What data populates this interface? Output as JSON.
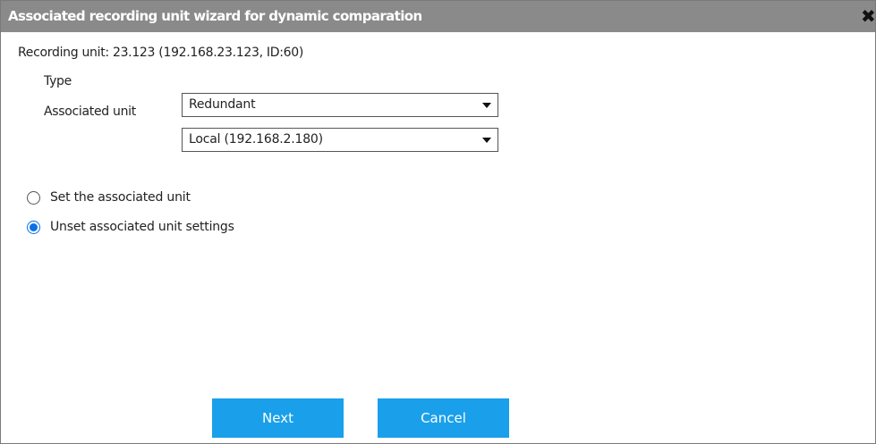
{
  "dialog": {
    "title": "Associated recording unit wizard for dynamic comparation",
    "close_glyph": "✖",
    "recording_unit": "Recording unit: 23.123 (192.168.23.123, ID:60)"
  },
  "form": {
    "type_label": "Type",
    "type_value": "Redundant",
    "associated_label": "Associated unit",
    "associated_value": "Local (192.168.2.180)"
  },
  "options": [
    {
      "label": "Set the associated unit",
      "checked": false
    },
    {
      "label": "Unset associated unit settings",
      "checked": true
    }
  ],
  "buttons": {
    "next": "Next",
    "cancel": "Cancel"
  },
  "colors": {
    "titlebar": "#8a8a8a",
    "accent": "#1aa0ea",
    "radio_checked": "#0a70e6"
  }
}
